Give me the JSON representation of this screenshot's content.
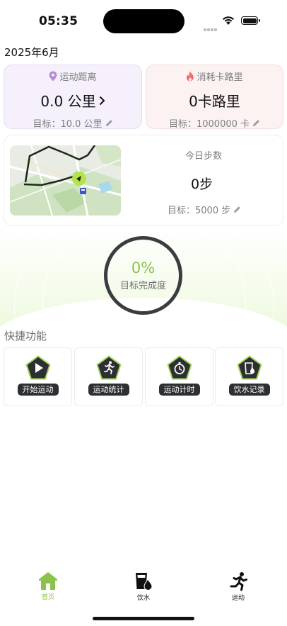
{
  "status_bar": {
    "time": "05:35"
  },
  "date_label": "2025年6月",
  "distance_card": {
    "title": "运动距离",
    "value": "0.0 公里",
    "goal": "目标：10.0 公里",
    "icon": "location-pin-icon",
    "color": "#b48ad6"
  },
  "calorie_card": {
    "title": "消耗卡路里",
    "value": "0卡路里",
    "goal": "目标：1000000 卡",
    "icon": "flame-icon",
    "color": "#f06a6a"
  },
  "steps_card": {
    "title": "今日步数",
    "value": "0步",
    "goal": "目标：5000 步"
  },
  "progress": {
    "percent_text": "0%",
    "label": "目标完成度",
    "value": 0
  },
  "quick": {
    "title": "快捷功能",
    "items": [
      {
        "label": "开始运动",
        "icon": "play-icon"
      },
      {
        "label": "运动统计",
        "icon": "running-person-icon"
      },
      {
        "label": "运动计时",
        "icon": "stopwatch-icon"
      },
      {
        "label": "饮水记录",
        "icon": "water-cup-icon"
      }
    ]
  },
  "tabbar": {
    "items": [
      {
        "label": "首页",
        "icon": "home-icon",
        "active": true
      },
      {
        "label": "饮水",
        "icon": "water-cup-icon",
        "active": false
      },
      {
        "label": "运动",
        "icon": "running-person-icon",
        "active": false
      }
    ],
    "accent": "#8bc34a"
  }
}
